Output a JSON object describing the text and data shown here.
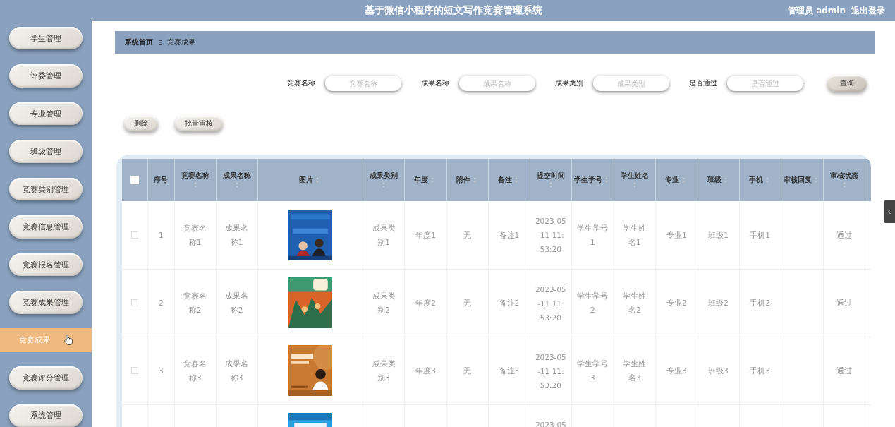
{
  "header": {
    "title": "基于微信小程序的短文写作竞赛管理系统",
    "user": "管理员 admin",
    "logout": "退出登录"
  },
  "sidebar": {
    "items": [
      {
        "label": "学生管理",
        "kind": "menu",
        "selected": false
      },
      {
        "label": "评委管理",
        "kind": "menu",
        "selected": false
      },
      {
        "label": "专业管理",
        "kind": "menu",
        "selected": false
      },
      {
        "label": "班级管理",
        "kind": "menu",
        "selected": false
      },
      {
        "label": "竞赛类别管理",
        "kind": "menu",
        "selected": false
      },
      {
        "label": "竞赛信息管理",
        "kind": "menu",
        "selected": false
      },
      {
        "label": "竞赛报名管理",
        "kind": "menu",
        "selected": false
      },
      {
        "label": "竞赛成果管理",
        "kind": "menu",
        "selected": false
      },
      {
        "label": "竞赛成果",
        "kind": "submenu",
        "selected": true
      },
      {
        "label": "竞赛评分管理",
        "kind": "menu",
        "selected": false
      },
      {
        "label": "系统管理",
        "kind": "menu",
        "selected": false
      }
    ]
  },
  "breadcrumb": {
    "items": [
      "系统首页",
      "竞赛成果"
    ],
    "separator": "Ξ"
  },
  "search": {
    "fields": [
      {
        "label": "竞赛名称",
        "placeholder": "竞赛名称",
        "kind": "input"
      },
      {
        "label": "成果名称",
        "placeholder": "成果名称",
        "kind": "input"
      },
      {
        "label": "成果类别",
        "placeholder": "成果类别",
        "kind": "input"
      },
      {
        "label": "是否通过",
        "placeholder": "是否通过",
        "kind": "select"
      }
    ],
    "button": "查询"
  },
  "actions": [
    "删除",
    "批量审核"
  ],
  "table": {
    "select_all": {
      "checked": false
    },
    "columns": [
      {
        "label": "序号",
        "sortable": false
      },
      {
        "label": "竞赛名称",
        "sortable": true
      },
      {
        "label": "成果名称",
        "sortable": true
      },
      {
        "label": "图片",
        "sortable": true
      },
      {
        "label": "成果类别",
        "sortable": true
      },
      {
        "label": "年度",
        "sortable": true
      },
      {
        "label": "附件",
        "sortable": true
      },
      {
        "label": "备注",
        "sortable": true
      },
      {
        "label": "提交时间",
        "sortable": true
      },
      {
        "label": "学生学号",
        "sortable": true
      },
      {
        "label": "学生姓名",
        "sortable": true
      },
      {
        "label": "专业",
        "sortable": true
      },
      {
        "label": "班级",
        "sortable": true
      },
      {
        "label": "手机",
        "sortable": true
      },
      {
        "label": "审核回复",
        "sortable": true
      },
      {
        "label": "审核状态",
        "sortable": true
      }
    ],
    "rows": [
      {
        "checked": false,
        "cells": [
          "1",
          "竞赛名称1",
          "成果名称1",
          {
            "kind": "picture"
          },
          "成果类别1",
          "年度1",
          "无",
          "备注1",
          "2023-05-11 11:53:20",
          "学生学号1",
          "学生姓名1",
          "专业1",
          "班级1",
          "手机1",
          null,
          "通过"
        ]
      },
      {
        "checked": false,
        "cells": [
          "2",
          "竞赛名称2",
          "成果名称2",
          {
            "kind": "picture"
          },
          "成果类别2",
          "年度2",
          "无",
          "备注2",
          "2023-05-11 11:53:20",
          "学生学号2",
          "学生姓名2",
          "专业2",
          "班级2",
          "手机2",
          null,
          "通过"
        ]
      },
      {
        "checked": false,
        "cells": [
          "3",
          "竞赛名称3",
          "成果名称3",
          {
            "kind": "picture"
          },
          "成果类别3",
          "年度3",
          "无",
          "备注3",
          "2023-05-11 11:53:20",
          "学生学号3",
          "学生姓名3",
          "专业3",
          "班级3",
          "手机3",
          null,
          "通过"
        ]
      },
      {
        "cells": [
          null,
          null,
          null,
          {
            "kind": "picture"
          },
          null,
          null,
          null,
          null,
          "2023-05",
          null,
          null,
          null,
          null,
          null,
          null,
          null
        ]
      }
    ]
  }
}
